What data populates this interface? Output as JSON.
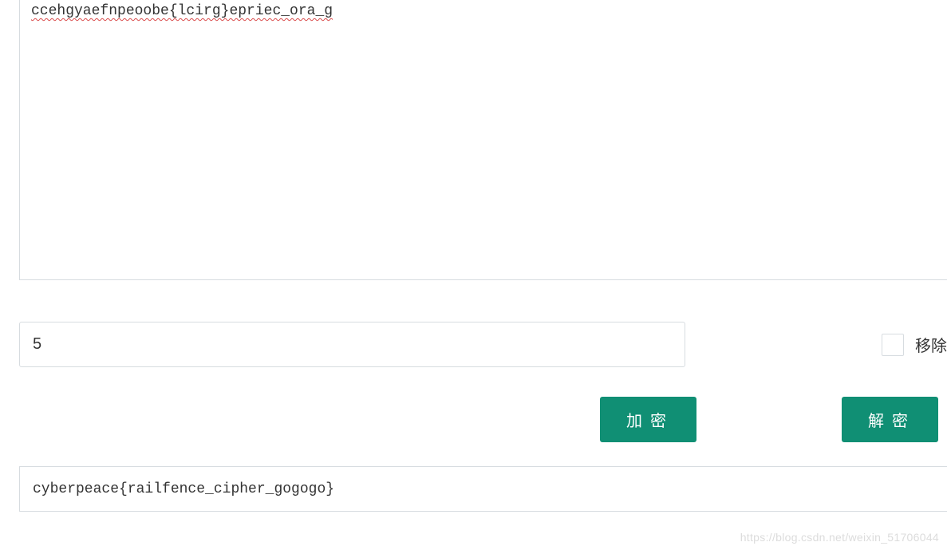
{
  "input": {
    "ciphertext": "ccehgyaefnpeoobe{lcirg}epriec_ora_g"
  },
  "key": {
    "value": "5"
  },
  "checkbox": {
    "label": "移除"
  },
  "buttons": {
    "encrypt": "加密",
    "decrypt": "解密"
  },
  "output": {
    "plaintext": "cyberpeace{railfence_cipher_gogogo}"
  },
  "watermark": "https://blog.csdn.net/weixin_51706044"
}
